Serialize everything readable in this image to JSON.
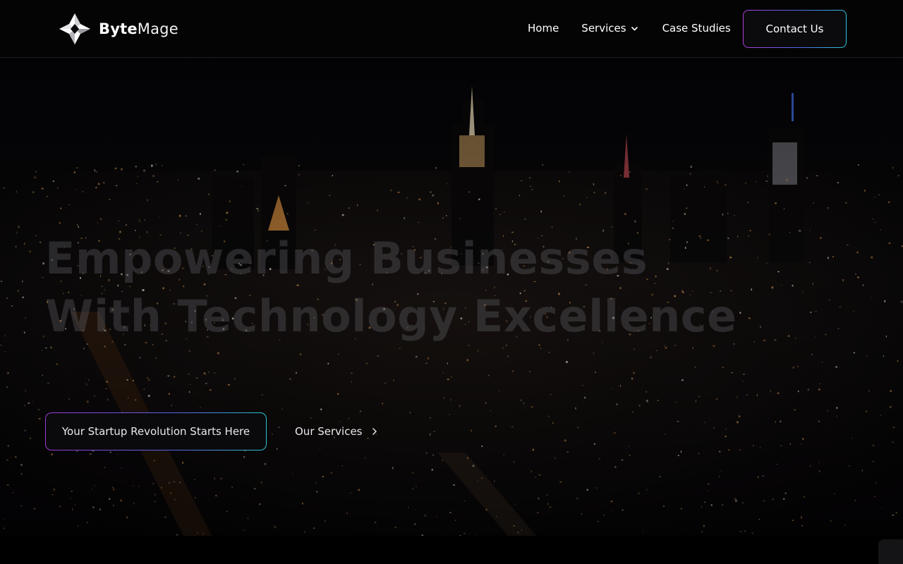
{
  "header": {
    "brand_bold": "Byte",
    "brand_light": "Mage",
    "logo_icon": "diamond-star-logo-icon",
    "nav": {
      "home": "Home",
      "services": "Services",
      "case_studies": "Case Studies"
    },
    "contact_label": "Contact Us"
  },
  "hero": {
    "headline_line1": "Empowering Businesses",
    "headline_line2": "With Technology Excellence",
    "primary_cta": "Your Startup Revolution Starts Here",
    "secondary_cta": "Our Services",
    "background": "night-city-skyline"
  },
  "colors": {
    "background": "#000000",
    "gradient_start": "#b13ad9",
    "gradient_mid": "#4d6be6",
    "gradient_end": "#2cc8d8"
  }
}
